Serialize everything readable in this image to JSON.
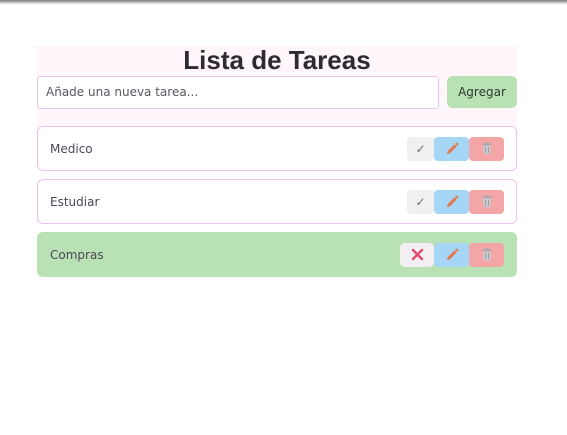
{
  "app": {
    "title": "Lista de Tareas"
  },
  "new_task": {
    "placeholder": "Añade una nueva tarea...",
    "value": "",
    "add_label": "Agregar"
  },
  "tasks": [
    {
      "label": "Medico",
      "completed": false,
      "toggle_glyph": "✓"
    },
    {
      "label": "Estudiar",
      "completed": false,
      "toggle_glyph": "✓"
    },
    {
      "label": "Compras",
      "completed": true,
      "toggle_glyph": "✕"
    }
  ],
  "icons": {
    "complete": "check-icon",
    "undo": "close-icon",
    "edit": "pencil-icon",
    "delete": "trash-icon"
  },
  "colors": {
    "accent_green": "#b9e2b4",
    "edit_blue": "#a6d6f5",
    "delete_red": "#f4a6a6",
    "task_border": "#ecc3ec",
    "undo_x": "#e2496f",
    "pencil": "#e07a4e"
  }
}
